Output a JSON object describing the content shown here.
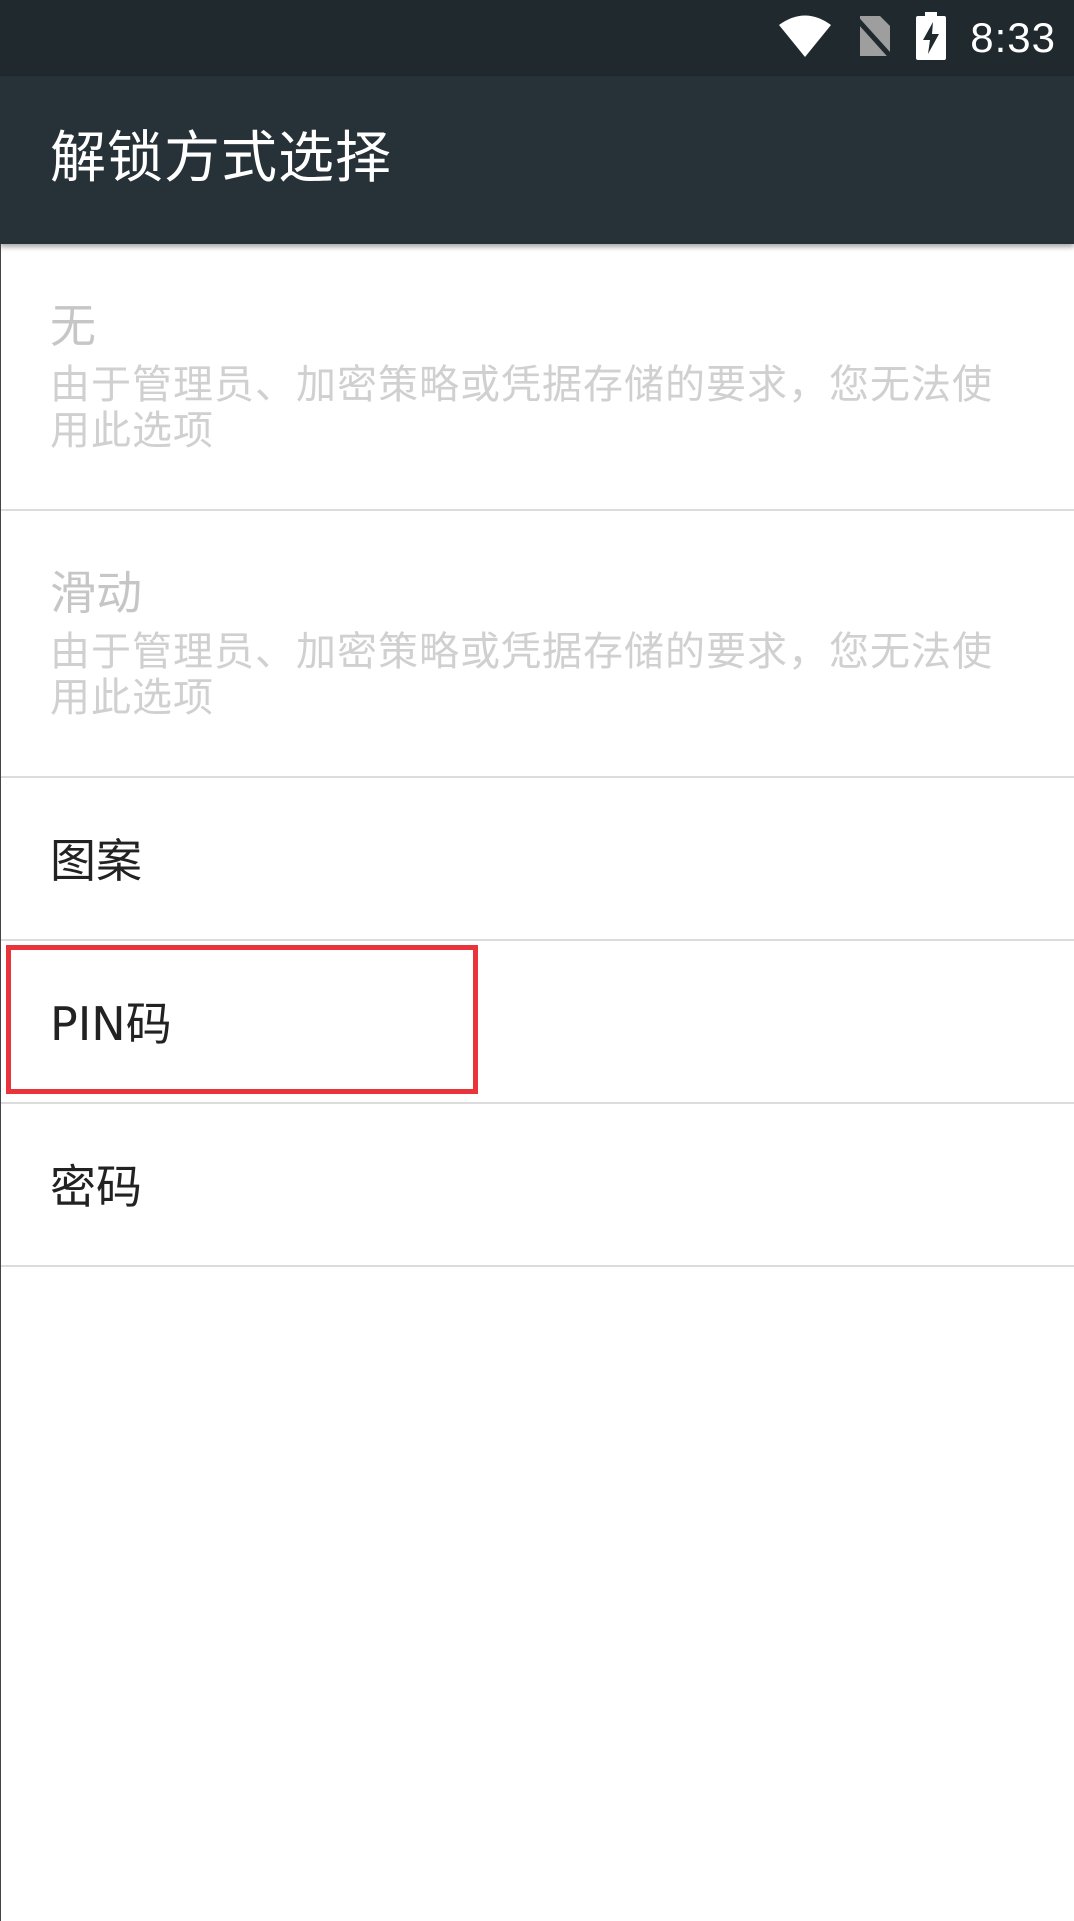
{
  "status_bar": {
    "time": "8:33",
    "icons": [
      "wifi-icon",
      "no-sim-icon",
      "battery-charging-icon"
    ]
  },
  "app_bar": {
    "title": "解锁方式选择"
  },
  "options": [
    {
      "title": "无",
      "summary": "由于管理员、加密策略或凭据存储的要求，您无法使用此选项",
      "enabled": false
    },
    {
      "title": "滑动",
      "summary": "由于管理员、加密策略或凭据存储的要求，您无法使用此选项",
      "enabled": false
    },
    {
      "title": "图案",
      "enabled": true
    },
    {
      "title": "PIN码",
      "enabled": true,
      "highlighted": true
    },
    {
      "title": "密码",
      "enabled": true
    }
  ],
  "colors": {
    "status_bar": "#1f292e",
    "app_bar": "#263238",
    "highlight": "#e8343a",
    "disabled_text": "#c6c6c6",
    "divider": "#dcdcdc"
  }
}
